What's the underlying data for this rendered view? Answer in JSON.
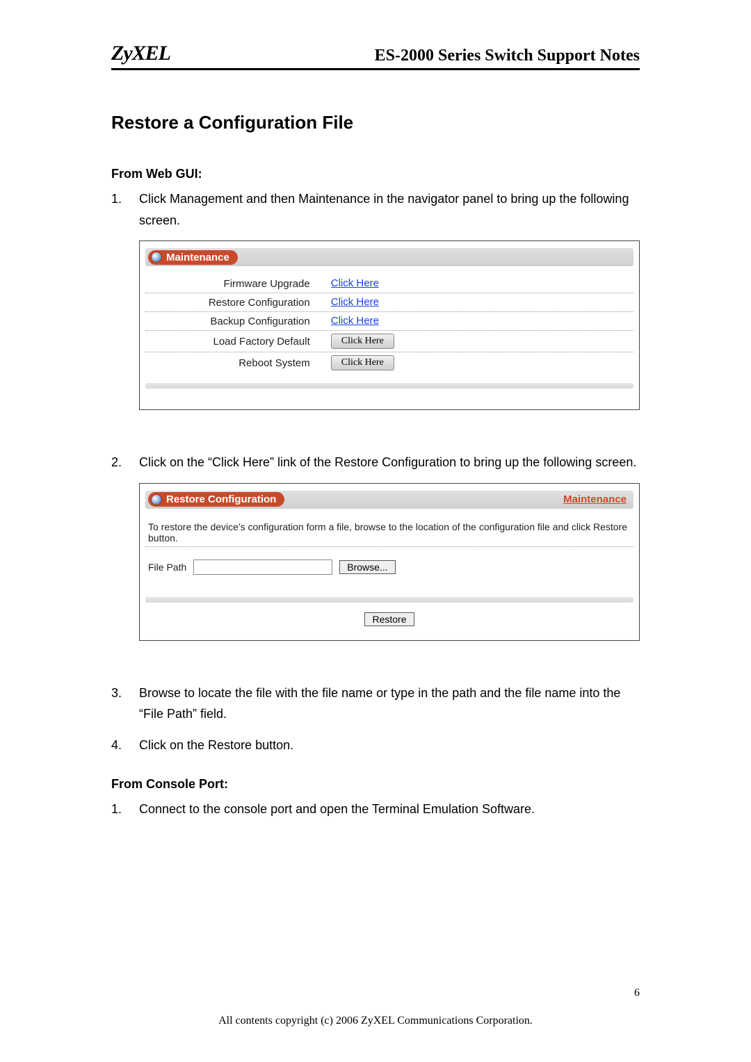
{
  "header": {
    "logo": "ZyXEL",
    "doc_title": "ES-2000 Series Switch Support Notes"
  },
  "section_heading": "Restore a Configuration File",
  "web_gui": {
    "heading": "From Web GUI:",
    "steps": [
      "Click Management and then Maintenance in the navigator panel to bring up the following screen.",
      "Click on the “Click Here” link of the Restore Configuration to bring up the following screen.",
      "Browse to locate the file with the file name or type in the path and the file name into the “File Path” field.",
      "Click on the Restore button."
    ]
  },
  "maintenance_panel": {
    "title": "Maintenance",
    "rows": [
      {
        "label": "Firmware Upgrade",
        "action_type": "link",
        "action_text": "Click Here"
      },
      {
        "label": "Restore Configuration",
        "action_type": "link",
        "action_text": "Click Here"
      },
      {
        "label": "Backup Configuration",
        "action_type": "link",
        "action_text": "Click Here"
      },
      {
        "label": "Load Factory Default",
        "action_type": "button",
        "action_text": "Click Here"
      },
      {
        "label": "Reboot System",
        "action_type": "button",
        "action_text": "Click Here"
      }
    ]
  },
  "restore_panel": {
    "title": "Restore Configuration",
    "back_link": "Maintenance",
    "description": "To restore the device's configuration form a file, browse to the location of the configuration file and click Restore button.",
    "file_label": "File Path",
    "browse_label": "Browse...",
    "restore_label": "Restore"
  },
  "console": {
    "heading": "From Console Port:",
    "steps": [
      "Connect to the console port and open the Terminal Emulation Software."
    ]
  },
  "footer": {
    "copyright": "All contents copyright (c) 2006 ZyXEL Communications Corporation.",
    "page_number": "6"
  }
}
